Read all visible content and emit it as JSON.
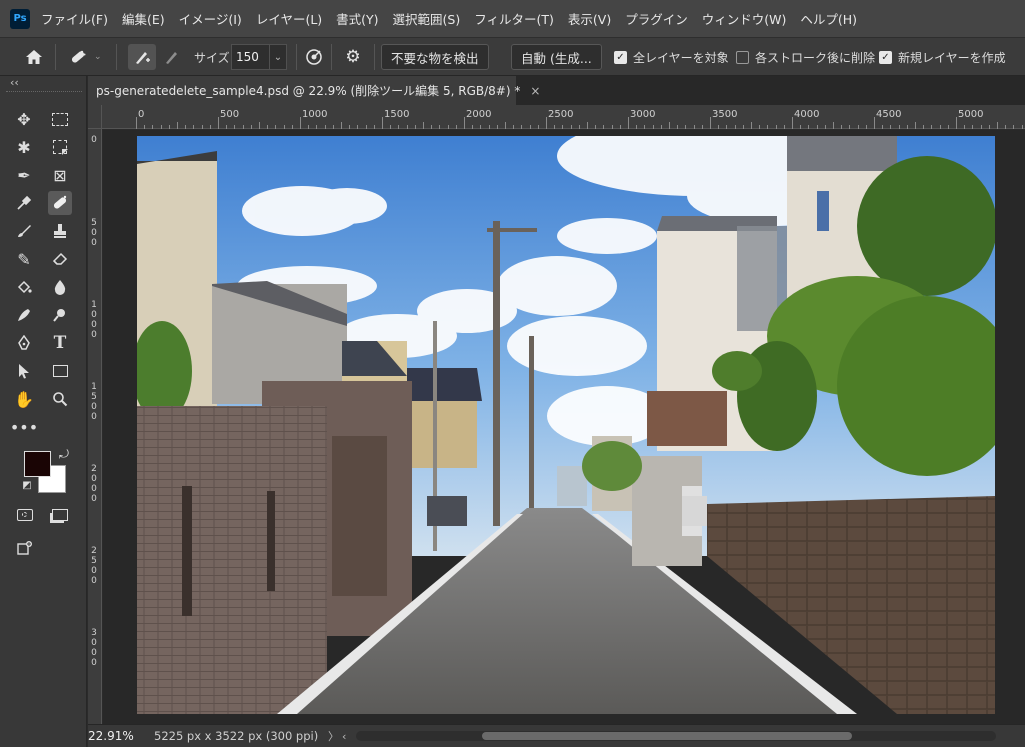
{
  "app": {
    "logo_text": "Ps"
  },
  "menu": [
    "ファイル(F)",
    "編集(E)",
    "イメージ(I)",
    "レイヤー(L)",
    "書式(Y)",
    "選択範囲(S)",
    "フィルター(T)",
    "表示(V)",
    "プラグイン",
    "ウィンドウ(W)",
    "ヘルプ(H)"
  ],
  "options": {
    "size_label": "サイズ",
    "size_value": "150",
    "detect_button": "不要な物を検出",
    "mode_button": "自動 (生成...",
    "all_layers_label": "全レイヤーを対象",
    "all_layers_checked": true,
    "delete_after_stroke_label": "各ストローク後に削除",
    "delete_after_stroke_checked": false,
    "new_layer_label": "新規レイヤーを作成",
    "new_layer_checked": true
  },
  "tools": [
    "move-tool",
    "marquee-tool",
    "lasso-tool",
    "crop-tool",
    "pen-tool-2",
    "frame-tool",
    "eyedropper-tool",
    "remove-tool",
    "brush-tool",
    "clone-stamp-tool",
    "history-brush-tool",
    "eraser-tool",
    "fill-tool",
    "blur-tool",
    "dodge-tool",
    "sharpen-tool",
    "pen-tool",
    "type-tool",
    "path-select-tool",
    "rectangle-tool",
    "hand-tool",
    "zoom-tool",
    "more-tools"
  ],
  "colors": {
    "foreground": "#1a0505",
    "background": "#ffffff",
    "accent": "#31a8ff"
  },
  "document": {
    "tab_title": "ps-generatedelete_sample4.psd @ 22.9% (削除ツール編集 5, RGB/8#) *",
    "close_symbol": "×"
  },
  "ruler": {
    "h_labels": [
      "0",
      "500",
      "1000",
      "1500",
      "2000",
      "2500",
      "3000",
      "3500",
      "4000",
      "4500",
      "5000"
    ],
    "v_labels": [
      "0",
      "500",
      "1000",
      "1500",
      "2000",
      "2500",
      "3000"
    ]
  },
  "status": {
    "zoom": "22.91%",
    "doc_info": "5225 px x 3522 px (300 ppi)",
    "arrow": "〉"
  }
}
